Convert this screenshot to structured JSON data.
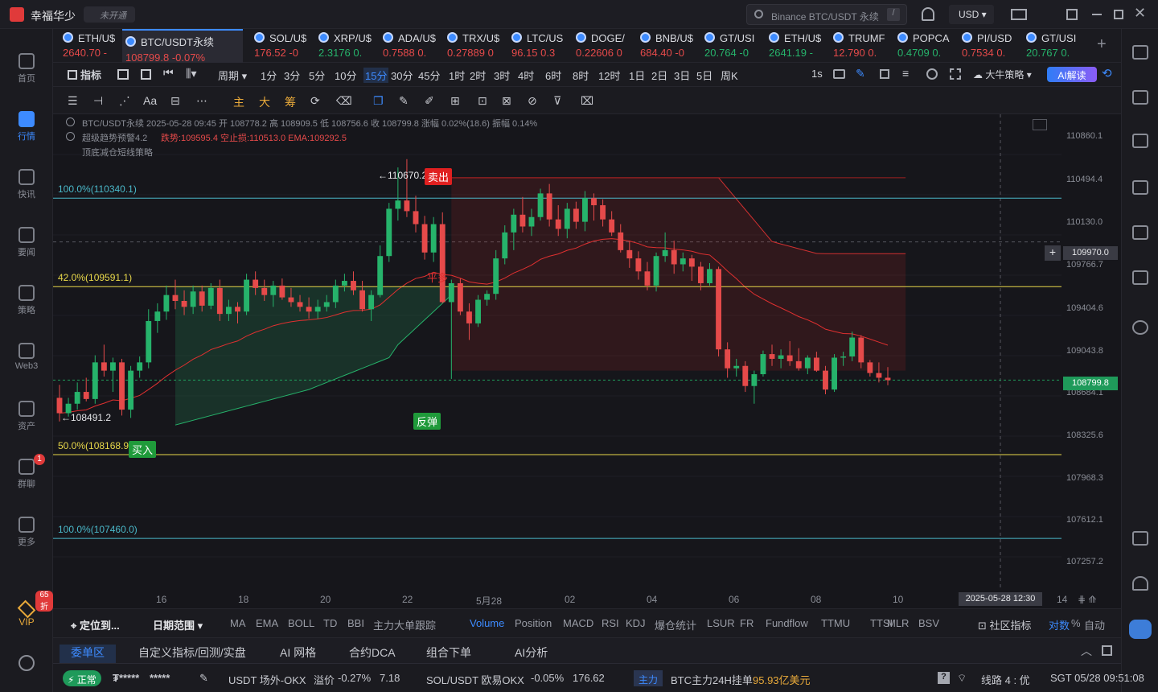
{
  "app": {
    "title": "幸福华少",
    "badge": "未开通",
    "search_placeholder": "Binance BTC/USDT 永续",
    "search_key": "/",
    "currency": "USD"
  },
  "tickers": [
    {
      "name": "ETH/U$",
      "price": "2640.70 -",
      "up": false
    },
    {
      "name": "BTC/USDT永续",
      "price": "108799.8 -0.07%",
      "up": false,
      "active": true
    },
    {
      "name": "SOL/U$",
      "price": "176.52 -0",
      "up": false
    },
    {
      "name": "XRP/U$",
      "price": "2.3176 0.",
      "up": true
    },
    {
      "name": "ADA/U$",
      "price": "0.7588 0.",
      "up": false
    },
    {
      "name": "TRX/U$",
      "price": "0.27889 0",
      "up": false
    },
    {
      "name": "LTC/US",
      "price": "96.15 0.3",
      "up": false
    },
    {
      "name": "DOGE/",
      "price": "0.22606 0",
      "up": false
    },
    {
      "name": "BNB/U$",
      "price": "684.40 -0",
      "up": false
    },
    {
      "name": "GT/USI",
      "price": "20.764 -0",
      "up": true
    },
    {
      "name": "ETH/U$",
      "price": "2641.19 -",
      "up": true
    },
    {
      "name": "TRUMF",
      "price": "12.790 0.",
      "up": false
    },
    {
      "name": "POPCA",
      "price": "0.4709 0.",
      "up": true
    },
    {
      "name": "PI/USD",
      "price": "0.7534 0.",
      "up": false
    },
    {
      "name": "GT/USI",
      "price": "20.767 0.",
      "up": true
    }
  ],
  "sidebar": [
    {
      "key": "home",
      "label": "首页"
    },
    {
      "key": "market",
      "label": "行情",
      "active": true
    },
    {
      "key": "news",
      "label": "快讯"
    },
    {
      "key": "important",
      "label": "要闻"
    },
    {
      "key": "strategy",
      "label": "策略"
    },
    {
      "key": "web3",
      "label": "Web3"
    },
    {
      "key": "assets",
      "label": "资产"
    },
    {
      "key": "group",
      "label": "群聊",
      "badge": "1"
    },
    {
      "key": "more",
      "label": "更多"
    }
  ],
  "vip": {
    "label": "VIP",
    "discount": "65折"
  },
  "toolbar1": {
    "indicator": "指标",
    "period": "周期",
    "timeframes": [
      "1分",
      "3分",
      "5分",
      "10分",
      "15分",
      "30分",
      "45分",
      "1时",
      "2时",
      "3时",
      "4时",
      "6时",
      "8时",
      "12时",
      "1日",
      "2日",
      "3日",
      "5日",
      "周K"
    ],
    "selected": "15分",
    "seconds": "1s",
    "strategy": "大牛策略",
    "ai": "AI解读"
  },
  "toolbar2": {
    "labels": [
      "主",
      "大",
      "筹"
    ]
  },
  "chart_info": {
    "line1": "BTC/USDT永续 2025-05-28 09:45 开 108778.2 高 108909.5 低 108756.6 收 108799.8 涨幅 0.02%(18.6) 振幅 0.14%",
    "line2_a": "超级趋势预警4.2",
    "line2_b": "跌势:109595.4 空止损:110513.0 EMA:109292.5",
    "line3": "顶底减仓短线策略"
  },
  "price_axis": [
    "110860.1",
    "110494.4",
    "110130.0",
    "109766.7",
    "109404.6",
    "109043.8",
    "108684.1",
    "108325.6",
    "107968.3",
    "107612.1",
    "107257.2"
  ],
  "crosshair_price": "109970.0",
  "last_price": "108799.8",
  "x_axis": [
    "16",
    "18",
    "20",
    "22",
    "5月28",
    "02",
    "04",
    "06",
    "08",
    "10",
    "14"
  ],
  "crosshair_time": "2025-05-28 12:30",
  "fib": [
    {
      "label": "100.0%(110340.1)",
      "price": 110340.1,
      "color": "#4ab8c9"
    },
    {
      "label": "42.0%(109591.1)",
      "price": 109591.1,
      "color": "#e8d84a"
    },
    {
      "label": "50.0%(108168.9)",
      "price": 108168.9,
      "color": "#e8d84a"
    },
    {
      "label": "100.0%(107460.0)",
      "price": 107460.0,
      "color": "#4ab8c9"
    }
  ],
  "annotations": {
    "high": "110670.2",
    "low": "108491.2",
    "sell": "卖出",
    "buy": "买入",
    "rebound": "反弹",
    "flat": "平多"
  },
  "chart_data": {
    "type": "candlestick",
    "series": "BTC/USDT永续 15分",
    "ylim": [
      107100,
      111050
    ],
    "candles": [
      [
        108650,
        108760,
        108450,
        108520
      ],
      [
        108520,
        108650,
        108491,
        108600
      ],
      [
        108600,
        108780,
        108550,
        108700
      ],
      [
        108700,
        108820,
        108620,
        108640
      ],
      [
        108640,
        109010,
        108600,
        108950
      ],
      [
        108950,
        109100,
        108830,
        108880
      ],
      [
        108880,
        108990,
        108700,
        108950
      ],
      [
        108950,
        108980,
        108500,
        108550
      ],
      [
        108550,
        108920,
        108480,
        108880
      ],
      [
        108880,
        109000,
        108820,
        108950
      ],
      [
        108950,
        109400,
        108900,
        109300
      ],
      [
        109300,
        109450,
        109200,
        109380
      ],
      [
        109380,
        109600,
        109310,
        109520
      ],
      [
        109520,
        109650,
        109400,
        109470
      ],
      [
        109470,
        109560,
        109350,
        109420
      ],
      [
        109420,
        109600,
        109360,
        109550
      ],
      [
        109550,
        109600,
        109380,
        109430
      ],
      [
        109430,
        109620,
        109400,
        109580
      ],
      [
        109580,
        109650,
        109300,
        109360
      ],
      [
        109360,
        109480,
        109300,
        109420
      ],
      [
        109420,
        109460,
        109280,
        109380
      ],
      [
        109380,
        109700,
        109350,
        109650
      ],
      [
        109650,
        109720,
        109520,
        109580
      ],
      [
        109580,
        109650,
        109470,
        109520
      ],
      [
        109520,
        109640,
        109420,
        109600
      ],
      [
        109600,
        109660,
        109480,
        109500
      ],
      [
        109500,
        109580,
        109420,
        109460
      ],
      [
        109460,
        109520,
        109380,
        109420
      ],
      [
        109420,
        109500,
        109320,
        109380
      ],
      [
        109380,
        109480,
        109320,
        109420
      ],
      [
        109420,
        109520,
        109380,
        109460
      ],
      [
        109460,
        109650,
        109410,
        109600
      ],
      [
        109600,
        109700,
        109550,
        109640
      ],
      [
        109640,
        109720,
        109520,
        109560
      ],
      [
        109560,
        109640,
        109380,
        109400
      ],
      [
        109400,
        109560,
        109300,
        109520
      ],
      [
        109520,
        109940,
        109500,
        109850
      ],
      [
        109850,
        110300,
        109800,
        110250
      ],
      [
        110250,
        110600,
        110150,
        110320
      ],
      [
        110320,
        110670,
        110180,
        110230
      ],
      [
        110230,
        110360,
        110050,
        110120
      ],
      [
        110120,
        110190,
        109820,
        109880
      ],
      [
        109880,
        110180,
        109800,
        110120
      ],
      [
        110120,
        110220,
        109450,
        109460
      ],
      [
        109460,
        109650,
        108810,
        109620
      ],
      [
        109620,
        109660,
        109350,
        109380
      ],
      [
        109380,
        109450,
        109140,
        109280
      ],
      [
        109280,
        109520,
        109250,
        109480
      ],
      [
        109480,
        109560,
        109430,
        109530
      ],
      [
        109530,
        109900,
        109480,
        109830
      ],
      [
        109830,
        110110,
        109780,
        110050
      ],
      [
        110050,
        110250,
        109900,
        110200
      ],
      [
        110200,
        110350,
        110050,
        110100
      ],
      [
        110100,
        110250,
        110020,
        110180
      ],
      [
        110180,
        110420,
        110150,
        110380
      ],
      [
        110380,
        110460,
        110100,
        110160
      ],
      [
        110160,
        110280,
        110020,
        110080
      ],
      [
        110080,
        110300,
        110000,
        110250
      ],
      [
        110250,
        110310,
        110080,
        110140
      ],
      [
        110140,
        110400,
        110060,
        110340
      ],
      [
        110340,
        110380,
        110150,
        110280
      ],
      [
        110280,
        110330,
        110100,
        110160
      ],
      [
        110160,
        110230,
        110020,
        110050
      ],
      [
        110050,
        110120,
        109880,
        109900
      ],
      [
        109900,
        109980,
        109750,
        109830
      ],
      [
        109830,
        109890,
        109650,
        109720
      ],
      [
        109720,
        109800,
        109560,
        109600
      ],
      [
        109600,
        109880,
        109550,
        109850
      ],
      [
        109850,
        110050,
        109800,
        109900
      ],
      [
        109900,
        109980,
        109700,
        109780
      ],
      [
        109780,
        109880,
        109720,
        109830
      ],
      [
        109830,
        109860,
        109640,
        109760
      ],
      [
        109760,
        109800,
        109560,
        109620
      ],
      [
        109620,
        109790,
        109600,
        109740
      ],
      [
        109740,
        109760,
        109000,
        109060
      ],
      [
        109060,
        109120,
        108820,
        108900
      ],
      [
        108900,
        108980,
        108830,
        108920
      ],
      [
        108920,
        108960,
        108700,
        108750
      ],
      [
        108750,
        108880,
        108600,
        108850
      ],
      [
        108850,
        109050,
        108830,
        109020
      ],
      [
        109020,
        109100,
        108920,
        108980
      ],
      [
        108980,
        109060,
        108900,
        109010
      ],
      [
        109010,
        109130,
        108920,
        108960
      ],
      [
        108960,
        109070,
        108880,
        108900
      ],
      [
        108900,
        109010,
        108850,
        108990
      ],
      [
        108990,
        109040,
        108870,
        108880
      ],
      [
        108880,
        108920,
        108680,
        108720
      ],
      [
        108720,
        109020,
        108700,
        108990
      ],
      [
        108990,
        109040,
        108920,
        109000
      ],
      [
        109000,
        109210,
        108960,
        109160
      ],
      [
        109160,
        109180,
        108900,
        108950
      ],
      [
        108950,
        108970,
        108830,
        108860
      ],
      [
        108860,
        108950,
        108780,
        108820
      ],
      [
        108820,
        108909.5,
        108756.6,
        108799.8
      ]
    ]
  },
  "bottom_tabs": {
    "locate": "定位到...",
    "range": "日期范围",
    "indicators": [
      "MA",
      "EMA",
      "BOLL",
      "TD",
      "BBI",
      "主力大单跟踪",
      "Volume",
      "Position",
      "MACD",
      "RSI",
      "KDJ",
      "爆仓统计",
      "LSUR",
      "FR",
      "Fundflow",
      "TTMU",
      "TTSI",
      "MLR",
      "BSV"
    ],
    "selected": "Volume",
    "community": "社区指标",
    "log": "对数",
    "pct": "%",
    "auto": "自动"
  },
  "panel_tabs": [
    "委单区",
    "自定义指标/回测/实盘",
    "AI 网格",
    "合约DCA",
    "组合下单",
    "AI分析"
  ],
  "status": {
    "state": "正常",
    "masked1": "₮*****",
    "masked2": "*****",
    "item1": "USDT 场外-OKX",
    "premium_label": "溢价",
    "premium": "-0.27%",
    "premium_val": "7.18",
    "item2": "SOL/USDT 欧易OKX",
    "item2_chg": "-0.05%",
    "item2_val": "176.62",
    "tag": "主力",
    "main_text": "BTC主力24H挂单",
    "main_val": "95.93亿美元",
    "line": "线路 4 : 优",
    "time": "SGT 05/28 09:51:08"
  }
}
